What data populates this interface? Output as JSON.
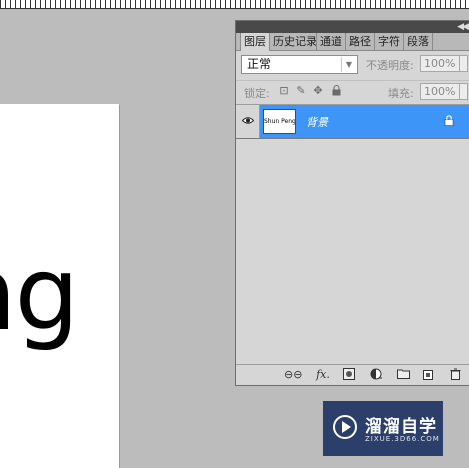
{
  "canvas": {
    "visible_text": "ng"
  },
  "layers_panel": {
    "tabs": [
      {
        "label": "图层",
        "active": true
      },
      {
        "label": "历史记录",
        "active": false
      },
      {
        "label": "通道",
        "active": false
      },
      {
        "label": "路径",
        "active": false
      },
      {
        "label": "字符",
        "active": false
      },
      {
        "label": "段落",
        "active": false
      }
    ],
    "blend_mode": "正常",
    "opacity_label": "不透明度:",
    "opacity_value": "100%",
    "lock_label": "锁定:",
    "fill_label": "填充:",
    "fill_value": "100%",
    "layers": [
      {
        "name": "背景",
        "thumbnail_text": "Shun Peng",
        "visible": true,
        "locked": true,
        "selected": true
      }
    ],
    "footer_icons": [
      "link-icon",
      "fx-icon",
      "mask-icon",
      "adjustment-icon",
      "group-folder-icon",
      "new-layer-icon",
      "trash-icon"
    ],
    "fx_label": "fx."
  },
  "watermark": {
    "title": "溜溜自学",
    "subtitle": "ZIXUE.3D66.COM"
  },
  "colors": {
    "selected_layer": "#3d96f7",
    "workspace": "#bcbcbc",
    "panel": "#d6d6d6",
    "logo_bg": "#2b3f6a"
  }
}
